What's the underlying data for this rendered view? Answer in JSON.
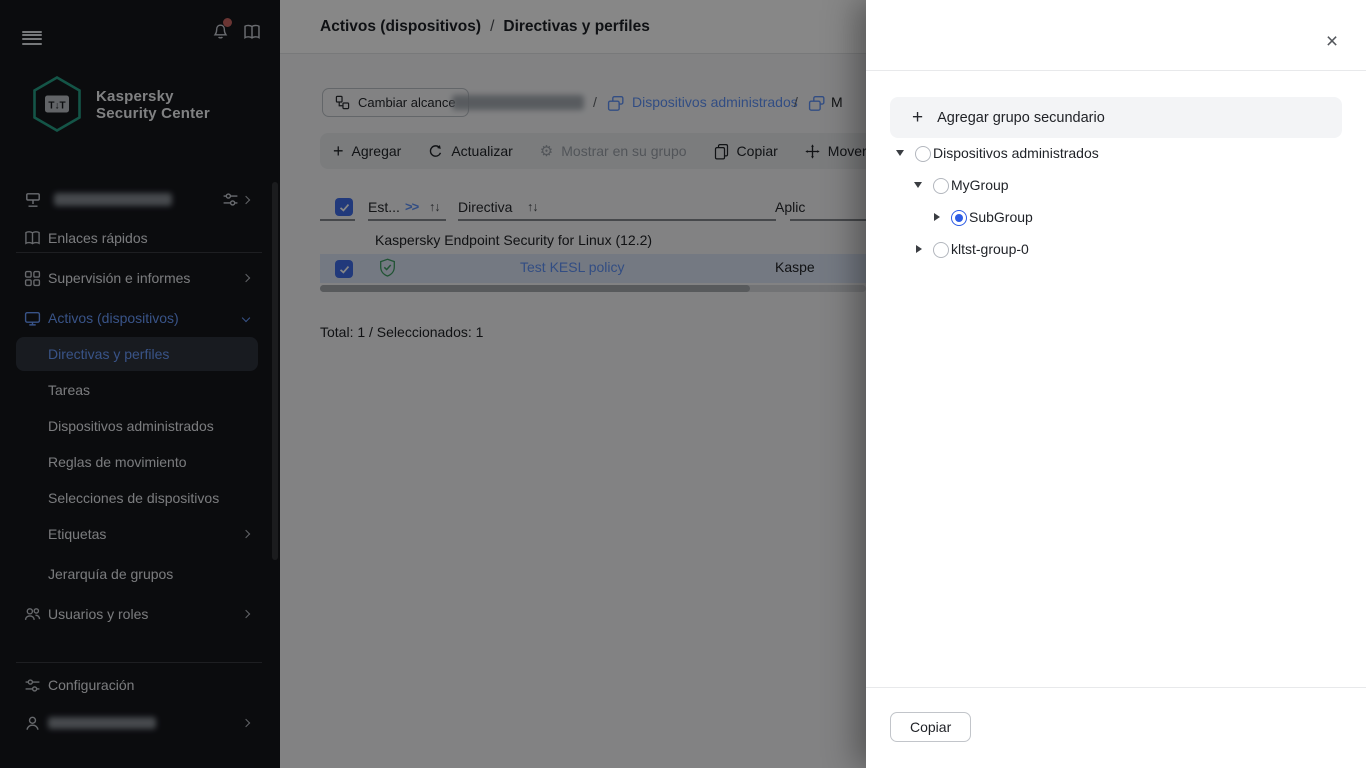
{
  "icons": {
    "slash": "/",
    "plus": "+",
    "close": "×",
    "sort": "↑↓",
    "expand_cols": ">>",
    "gear": "⚙",
    "logo_glyph": "T↓T"
  },
  "colors": {
    "accent_blue": "#2d5ce5",
    "sidebar_blue": "#6b9dff",
    "link_blue": "#5f92f7",
    "status_green": "#3f9e63",
    "alert_red": "#c96460",
    "sidebar_bg": "#15171c"
  },
  "sidebar": {
    "brand": {
      "line1": "Kaspersky",
      "line2": "Security Center"
    },
    "items": [
      {
        "label": "Enlaces rápidos"
      },
      {
        "label": "Supervisión e informes"
      },
      {
        "label": "Activos (dispositivos)"
      },
      {
        "label": "Directivas y perfiles"
      },
      {
        "label": "Tareas"
      },
      {
        "label": "Dispositivos administrados"
      },
      {
        "label": "Reglas de movimiento"
      },
      {
        "label": "Selecciones de dispositivos"
      },
      {
        "label": "Etiquetas"
      },
      {
        "label": "Jerarquía de grupos"
      },
      {
        "label": "Usuarios y roles"
      },
      {
        "label": "Configuración"
      }
    ]
  },
  "header": {
    "breadcrumb": [
      "Activos (dispositivos)",
      "Directivas y perfiles"
    ]
  },
  "scope_bar": {
    "change_scope": "Cambiar alcance",
    "crumbs": [
      {
        "label": "Dispositivos administrados"
      },
      {
        "label": "M"
      }
    ]
  },
  "toolbar": {
    "buttons": [
      {
        "label": "Agregar"
      },
      {
        "label": "Actualizar"
      },
      {
        "label": "Mostrar en su grupo"
      },
      {
        "label": "Copiar"
      },
      {
        "label": "Mover"
      }
    ]
  },
  "table": {
    "columns": {
      "status": "Est...",
      "policy": "Directiva",
      "application": "Aplic"
    },
    "group_row": "Kaspersky Endpoint Security for Linux (12.2)",
    "row": {
      "policy": "Test KESL policy",
      "application": "Kaspe"
    },
    "total": "Total: 1 / Seleccionados: 1"
  },
  "panel": {
    "add_group": "Agregar grupo secundario",
    "tree": [
      {
        "label": "Dispositivos administrados",
        "level": 0,
        "state": "expanded",
        "selected": false
      },
      {
        "label": "MyGroup",
        "level": 1,
        "state": "expanded",
        "selected": false
      },
      {
        "label": "SubGroup",
        "level": 2,
        "state": "collapsed",
        "selected": true
      },
      {
        "label": "kltst-group-0",
        "level": 1,
        "state": "collapsed",
        "selected": false
      }
    ],
    "copy": "Copiar"
  }
}
